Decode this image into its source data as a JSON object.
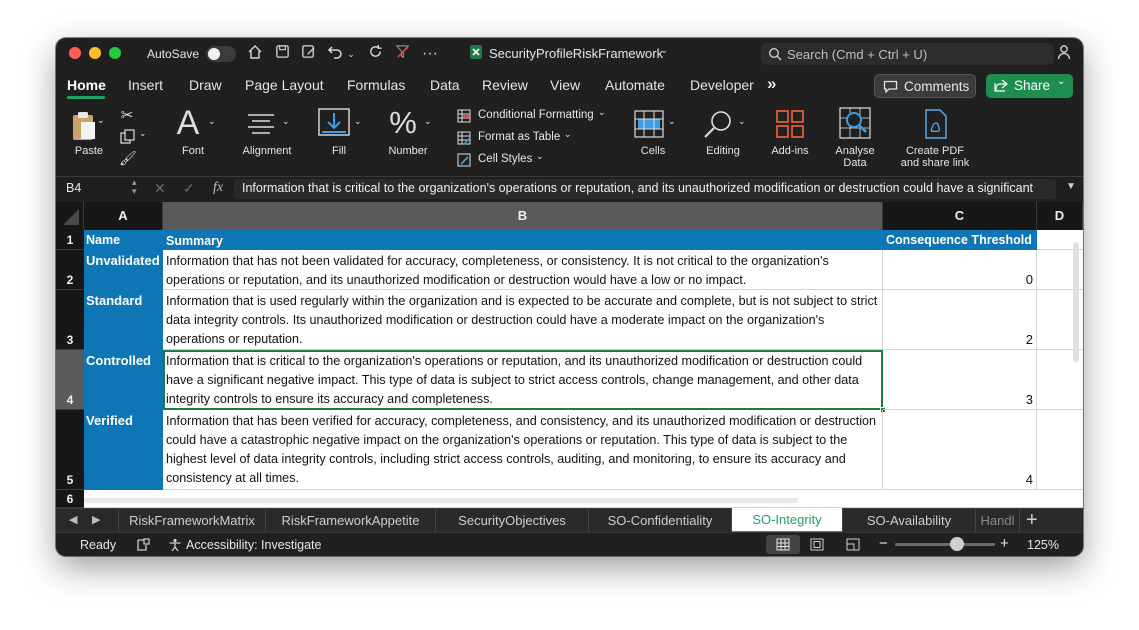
{
  "titlebar": {
    "autosave_label": "AutoSave",
    "doc_title": "SecurityProfileRiskFramework",
    "search_placeholder": "Search (Cmd + Ctrl + U)"
  },
  "tabs": [
    "Home",
    "Insert",
    "Draw",
    "Page Layout",
    "Formulas",
    "Data",
    "Review",
    "View",
    "Automate",
    "Developer"
  ],
  "tabs_more": "»",
  "comments_label": "Comments",
  "share_label": "Share",
  "ribbon": {
    "paste": "Paste",
    "font": "Font",
    "alignment": "Alignment",
    "fill": "Fill",
    "number": "Number",
    "conditional_formatting": "Conditional Formatting",
    "format_as_table": "Format as Table",
    "cell_styles": "Cell Styles",
    "cells": "Cells",
    "editing": "Editing",
    "addins": "Add-ins",
    "analyse_line1": "Analyse",
    "analyse_line2": "Data",
    "create_pdf_line1": "Create PDF",
    "create_pdf_line2": "and share link"
  },
  "formula_bar": {
    "name_box": "B4",
    "fx": "fx",
    "content": "Information that is critical to the organization's operations or reputation, and its unauthorized modification or destruction could have a significant"
  },
  "columns": [
    "A",
    "B",
    "C",
    "D"
  ],
  "header_row": {
    "row": "1",
    "name": "Name",
    "summary": "Summary",
    "threshold": "Consequence Threshold"
  },
  "rows": [
    {
      "row": "2",
      "name": "Unvalidated",
      "summary": "Information that has not been validated for accuracy, completeness, or consistency. It is not critical to the organization's operations or reputation, and its unauthorized modification or destruction would have a low or no impact.",
      "threshold": "0"
    },
    {
      "row": "3",
      "name": "Standard",
      "summary": "Information that is used regularly within the organization and is expected to be accurate and complete, but is not subject to strict data integrity controls. Its unauthorized modification or destruction could have a moderate impact on the organization's operations or reputation.",
      "threshold": "2"
    },
    {
      "row": "4",
      "name": "Controlled",
      "summary": "Information that is critical to the organization's operations or reputation, and its unauthorized modification or destruction could have a significant negative impact. This type of data is subject to strict access controls, change management, and other data integrity controls to ensure its accuracy and completeness.",
      "threshold": "3"
    },
    {
      "row": "5",
      "name": "Verified",
      "summary": "Information that has been verified for accuracy, completeness, and consistency, and its unauthorized modification or destruction could have a catastrophic negative impact on the organization's operations or reputation. This type of data is subject to the highest level of data integrity controls, including strict access controls, auditing, and monitoring, to ensure its accuracy and consistency at all times.",
      "threshold": "4"
    }
  ],
  "extra_row": "6",
  "sheet_tabs": [
    "RiskFrameworkMatrix",
    "RiskFrameworkAppetite",
    "SecurityObjectives",
    "SO-Confidentiality",
    "SO-Integrity",
    "SO-Availability",
    "Handl"
  ],
  "active_sheet": "SO-Integrity",
  "status": {
    "ready": "Ready",
    "accessibility": "Accessibility: Investigate",
    "zoom": "125%",
    "zoom_level": 0.62
  },
  "colors": {
    "accent_green": "#21a366",
    "header_blue": "#0f76b6",
    "active_tab_text": "#21a366"
  }
}
